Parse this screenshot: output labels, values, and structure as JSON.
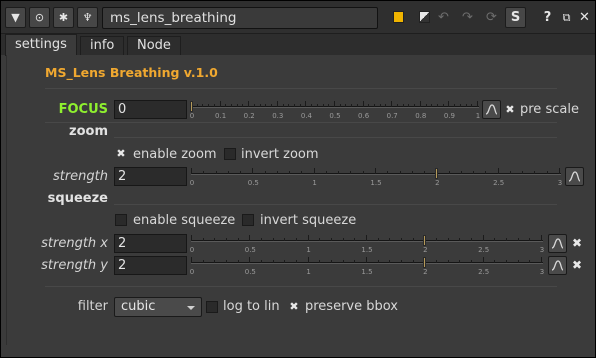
{
  "titlebar": {
    "node_name": "ms_lens_breathing",
    "help_label": "?",
    "s_label": "S"
  },
  "tabs": [
    {
      "label": "settings",
      "active": true
    },
    {
      "label": "info",
      "active": false
    },
    {
      "label": "Node",
      "active": false
    }
  ],
  "header": {
    "title": "MS_Lens Breathing v.1.0"
  },
  "focus": {
    "label": "FOCUS",
    "value": "0",
    "slider_min": 0,
    "slider_max": 1,
    "ticks": [
      "0",
      "0.1",
      "0.2",
      "0.3",
      "0.4",
      "0.5",
      "0.6",
      "0.7",
      "0.8",
      "0.9",
      "1"
    ],
    "pre_scale": {
      "label": "pre scale",
      "checked": true
    }
  },
  "zoom": {
    "section_label": "zoom",
    "enable": {
      "label": "enable zoom",
      "checked": true
    },
    "invert": {
      "label": "invert zoom",
      "checked": false
    },
    "strength": {
      "label": "strength",
      "value": "2",
      "ticks": [
        "0",
        "0.5",
        "1",
        "1.5",
        "2",
        "2.5",
        "3"
      ],
      "slider_min": 0,
      "slider_max": 3,
      "slider_value": 2
    }
  },
  "squeeze": {
    "section_label": "squeeze",
    "enable": {
      "label": "enable squeeze",
      "checked": false
    },
    "invert": {
      "label": "invert squeeze",
      "checked": false
    },
    "strength_x": {
      "label": "strength x",
      "value": "2",
      "ticks": [
        "0",
        "0.5",
        "1",
        "1.5",
        "2",
        "2.5",
        "3"
      ],
      "slider_min": 0,
      "slider_max": 3,
      "slider_value": 2
    },
    "strength_y": {
      "label": "strength y",
      "value": "2",
      "ticks": [
        "0",
        "0.5",
        "1",
        "1.5",
        "2",
        "2.5",
        "3"
      ],
      "slider_min": 0,
      "slider_max": 3,
      "slider_value": 2
    }
  },
  "footer": {
    "filter_label": "filter",
    "filter_value": "cubic",
    "log_to_lin": {
      "label": "log to lin",
      "checked": false
    },
    "preserve_bbox": {
      "label": "preserve bbox",
      "checked": true
    }
  },
  "colors": {
    "accent_orange": "#f0a830",
    "focus_green": "#8ff02f",
    "swatch_yellow": "#f0b400"
  },
  "icons": {
    "collapse": "triangle-down-icon",
    "viewer": "circle-dot-icon",
    "node": "bug-icon",
    "tools": "wrench-icon",
    "undo": "undo-icon",
    "redo": "redo-icon",
    "revert": "revert-icon",
    "float": "float-window-icon",
    "close": "close-icon",
    "curve": "curve-icon"
  }
}
